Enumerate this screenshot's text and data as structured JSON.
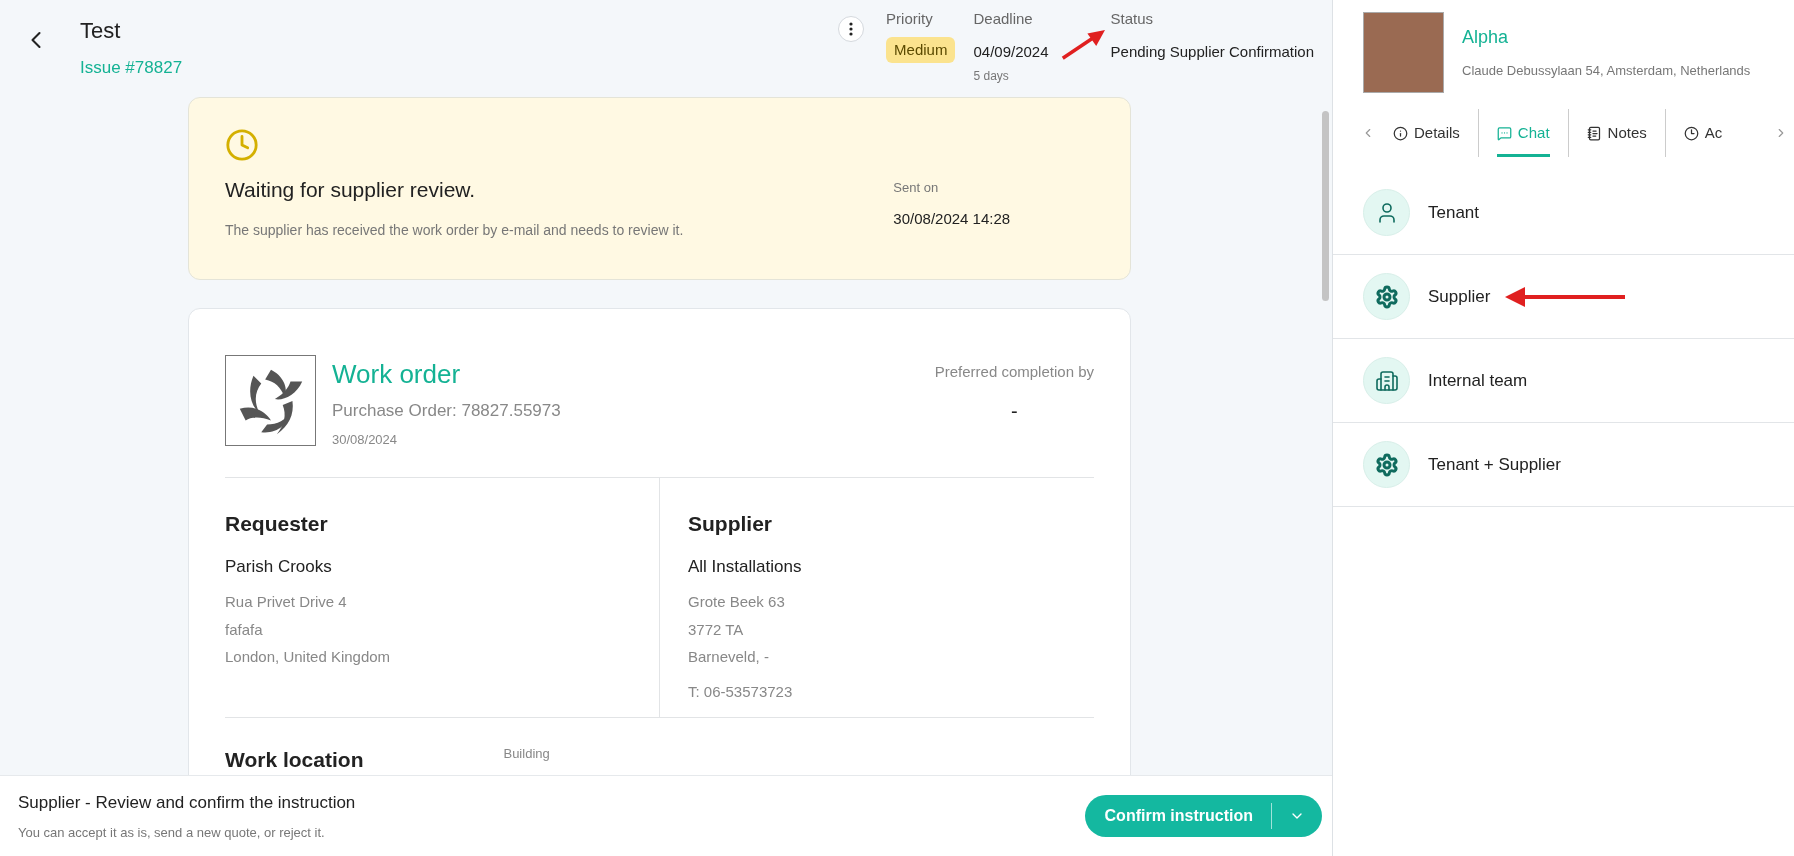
{
  "header": {
    "title": "Test",
    "issue": "Issue #78827",
    "priority": {
      "label": "Priority",
      "value": "Medium"
    },
    "deadline": {
      "label": "Deadline",
      "value": "04/09/2024",
      "sub": "5 days"
    },
    "status": {
      "label": "Status",
      "value": "Pending Supplier Confirmation"
    }
  },
  "notice": {
    "title": "Waiting for supplier review.",
    "text": "The supplier has received the work order by e-mail and needs to review it.",
    "sent_label": "Sent on",
    "sent_value": "30/08/2024 14:28"
  },
  "work_order": {
    "title": "Work order",
    "purchase_order": "Purchase Order: 78827.55973",
    "date": "30/08/2024",
    "completion_label": "Preferred completion by",
    "completion_value": "-",
    "requester": {
      "heading": "Requester",
      "name": "Parish Crooks",
      "lines": [
        "Rua Privet Drive 4",
        "fafafa",
        "London, United Kingdom"
      ]
    },
    "supplier": {
      "heading": "Supplier",
      "name": "All Installations",
      "lines": [
        "Grote Beek 63",
        "3772 TA",
        "Barneveld, -"
      ],
      "phone": "T: 06-53573723"
    },
    "location_heading": "Work location",
    "building_label": "Building"
  },
  "footer": {
    "title": "Supplier - Review and confirm the instruction",
    "text": "You can accept it as is, send a new quote, or reject it.",
    "button": "Confirm instruction"
  },
  "property": {
    "name": "Alpha",
    "address": "Claude Debussylaan 54, Amsterdam, Netherlands"
  },
  "tabs": [
    {
      "label": "Details",
      "kind": "info",
      "selected": false
    },
    {
      "label": "Chat",
      "kind": "chat",
      "selected": true
    },
    {
      "label": "Notes",
      "kind": "notes",
      "selected": false
    },
    {
      "label": "Ac",
      "kind": "clock",
      "selected": false
    }
  ],
  "channels": [
    {
      "label": "Tenant",
      "kind": "person",
      "annotated": false
    },
    {
      "label": "Supplier",
      "kind": "gear",
      "annotated": true
    },
    {
      "label": "Internal team",
      "kind": "building",
      "annotated": false
    },
    {
      "label": "Tenant + Supplier",
      "kind": "gear",
      "annotated": false
    }
  ],
  "status_annotated": true
}
